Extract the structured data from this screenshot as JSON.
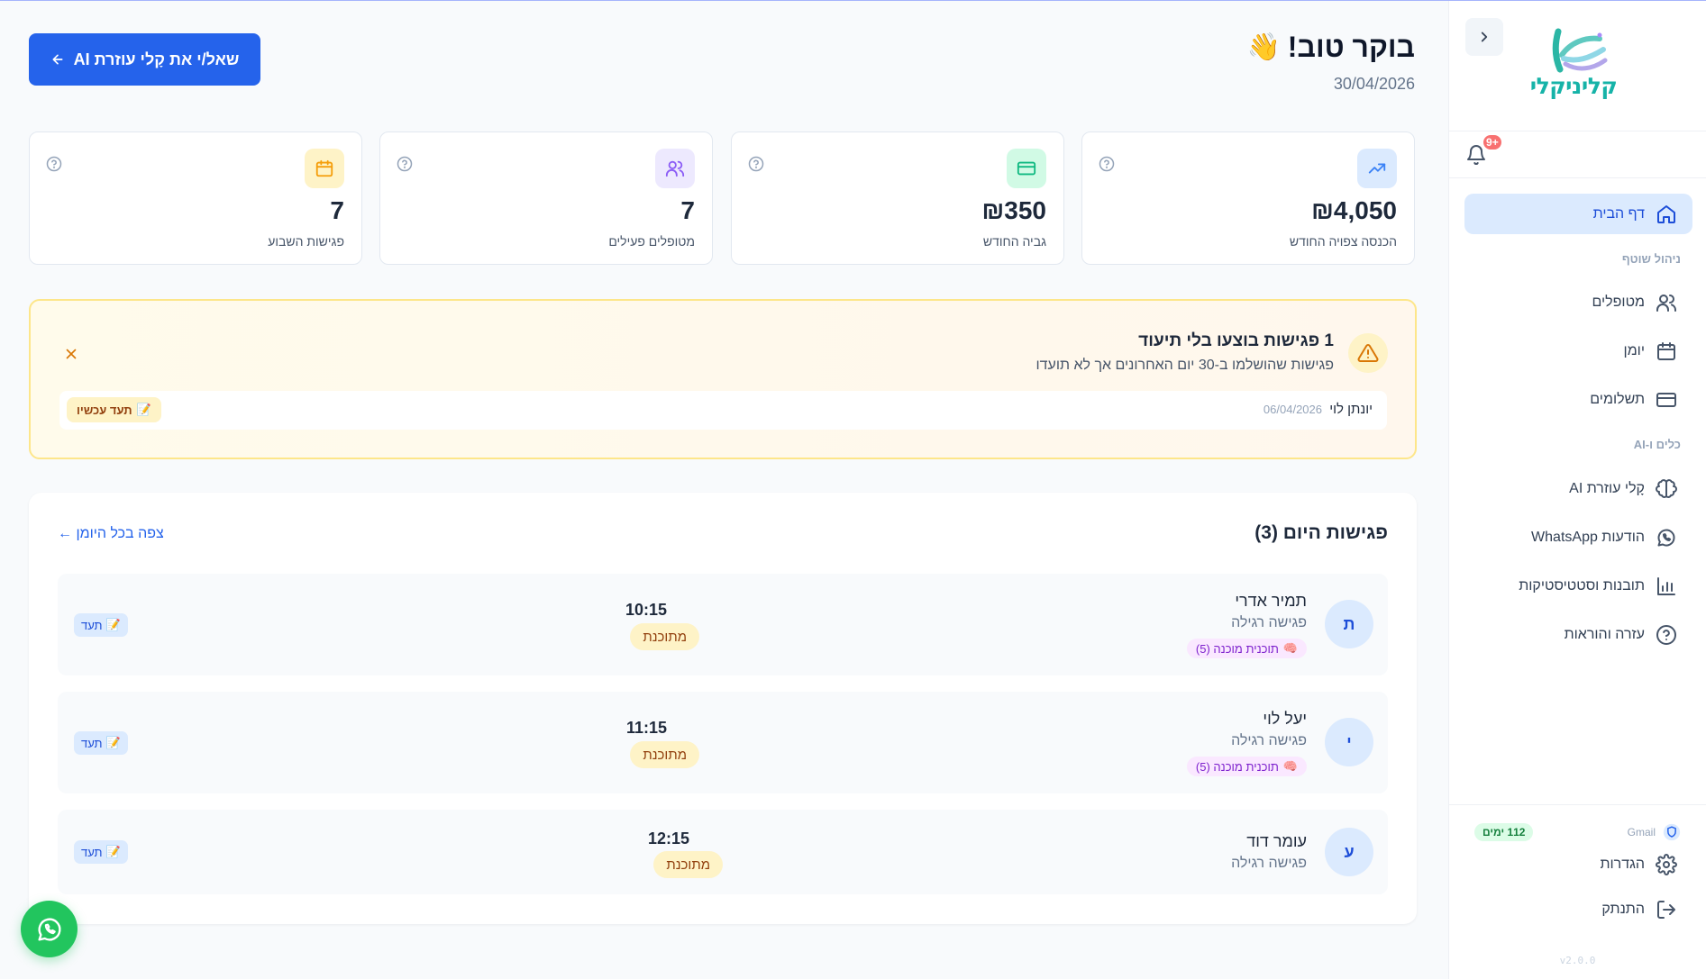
{
  "greeting": {
    "title": "בוקר טוב!",
    "emoji": "👋",
    "date": "30/04/2026"
  },
  "ask_button": {
    "label": "שאל/י את קָלי עוזרת AI",
    "arrow": "←"
  },
  "stats": [
    {
      "value": "₪4,050",
      "label": "הכנסה צפויה החודש",
      "icon": "trending-up-icon",
      "color": "#3b82f6"
    },
    {
      "value": "₪350",
      "label": "גביה החודש",
      "icon": "credit-card-icon",
      "color": "#10b981"
    },
    {
      "value": "7",
      "label": "מטופלים פעילים",
      "icon": "users-icon",
      "color": "#8b5cf6"
    },
    {
      "value": "7",
      "label": "פגישות השבוע",
      "icon": "calendar-icon",
      "color": "#f59e0b"
    }
  ],
  "alert": {
    "title": "1 פגישות בוצעו בלי תיעוד",
    "subtitle": "פגישות שהושלמו ב-30 יום האחרונים אך לא תועדו",
    "item": {
      "name": "יונתן לוי",
      "date": "06/04/2026",
      "action": "תעד עכשיו"
    }
  },
  "today": {
    "title": "פגישות היום (3)",
    "view_all": "צפה בכל היומן ←",
    "appointments": [
      {
        "initial": "ת",
        "name": "תמיר אדרי",
        "type": "פגישה רגילה",
        "plan": "תוכנית מוכנה (5)",
        "time": "10:15",
        "status": "מתוכנת",
        "action": "תעד"
      },
      {
        "initial": "י",
        "name": "יעל לוי",
        "type": "פגישה רגילה",
        "plan": "תוכנית מוכנה (5)",
        "time": "11:15",
        "status": "מתוכנת",
        "action": "תעד"
      },
      {
        "initial": "ע",
        "name": "עומר דוד",
        "type": "פגישה רגילה",
        "plan": "",
        "time": "12:15",
        "status": "מתוכנת",
        "action": "תעד"
      }
    ]
  },
  "sidebar": {
    "brand": "קליניקלי",
    "notifications_badge": "+9",
    "nav": {
      "home": "דף הבית",
      "section_ongoing": "ניהול שוטף",
      "patients": "מטופלים",
      "calendar": "יומן",
      "payments": "תשלומים",
      "section_tools": "כלים ו-AI",
      "ai_assistant": "קָלי עוזרת AI",
      "whatsapp": "הודעות WhatsApp",
      "insights": "תובנות וסטטיסטיקות",
      "help": "עזרה והוראות",
      "settings": "הגדרות",
      "logout": "התנתק"
    },
    "gmail": {
      "label": "Gmail",
      "days": "112 ימים"
    },
    "version": "v2.0.0"
  },
  "colors": {
    "primary": "#2563eb",
    "brand": "#16b3a8",
    "warning": "#f59e0b",
    "whatsapp": "#22c55e"
  }
}
